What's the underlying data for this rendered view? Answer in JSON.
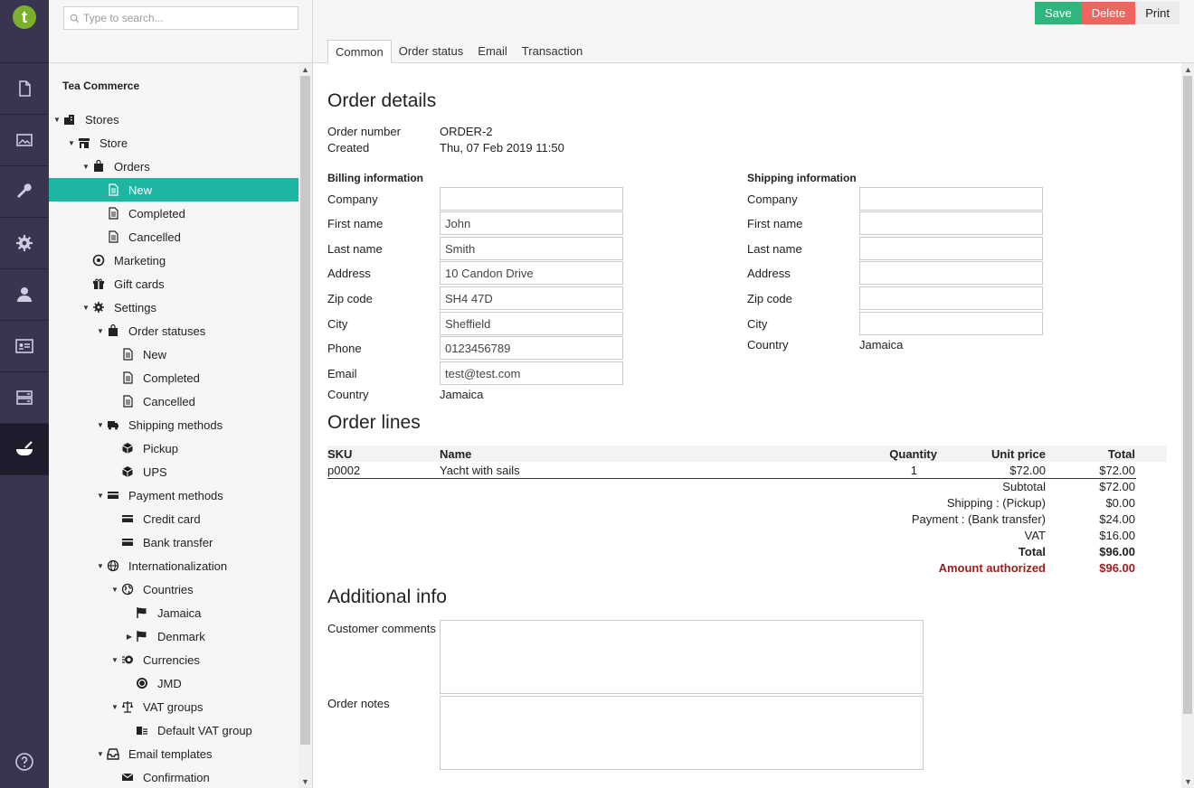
{
  "rail": {
    "logo_letter": "t",
    "items": [
      {
        "name": "content"
      },
      {
        "name": "media"
      },
      {
        "name": "developer"
      },
      {
        "name": "settings"
      },
      {
        "name": "users"
      },
      {
        "name": "members"
      },
      {
        "name": "forms"
      },
      {
        "name": "tea-commerce"
      }
    ]
  },
  "search": {
    "placeholder": "Type to search..."
  },
  "tree": {
    "section_title": "Tea Commerce",
    "nodes": [
      {
        "label": "Stores"
      },
      {
        "label": "Store"
      },
      {
        "label": "Orders"
      },
      {
        "label": "New"
      },
      {
        "label": "Completed"
      },
      {
        "label": "Cancelled"
      },
      {
        "label": "Marketing"
      },
      {
        "label": "Gift cards"
      },
      {
        "label": "Settings"
      },
      {
        "label": "Order statuses"
      },
      {
        "label": "New"
      },
      {
        "label": "Completed"
      },
      {
        "label": "Cancelled"
      },
      {
        "label": "Shipping methods"
      },
      {
        "label": "Pickup"
      },
      {
        "label": "UPS"
      },
      {
        "label": "Payment methods"
      },
      {
        "label": "Credit card"
      },
      {
        "label": "Bank transfer"
      },
      {
        "label": "Internationalization"
      },
      {
        "label": "Countries"
      },
      {
        "label": "Jamaica"
      },
      {
        "label": "Denmark"
      },
      {
        "label": "Currencies"
      },
      {
        "label": "JMD"
      },
      {
        "label": "VAT groups"
      },
      {
        "label": "Default VAT group"
      },
      {
        "label": "Email templates"
      },
      {
        "label": "Confirmation"
      }
    ]
  },
  "toolbar": {
    "save": "Save",
    "delete": "Delete",
    "print": "Print"
  },
  "tabs": [
    "Common",
    "Order status",
    "Email",
    "Transaction"
  ],
  "order_details": {
    "heading": "Order details",
    "order_number_label": "Order number",
    "order_number": "ORDER-2",
    "created_label": "Created",
    "created": "Thu, 07 Feb 2019 11:50"
  },
  "billing": {
    "title": "Billing information",
    "company_label": "Company",
    "company": "",
    "first_name_label": "First name",
    "first_name": "John",
    "last_name_label": "Last name",
    "last_name": "Smith",
    "address_label": "Address",
    "address": "10 Candon Drive",
    "zip_label": "Zip code",
    "zip": "SH4 47D",
    "city_label": "City",
    "city": "Sheffield",
    "phone_label": "Phone",
    "phone": "0123456789",
    "email_label": "Email",
    "email": "test@test.com",
    "country_label": "Country",
    "country": "Jamaica"
  },
  "shipping": {
    "title": "Shipping information",
    "company_label": "Company",
    "company": "",
    "first_name_label": "First name",
    "first_name": "",
    "last_name_label": "Last name",
    "last_name": "",
    "address_label": "Address",
    "address": "",
    "zip_label": "Zip code",
    "zip": "",
    "city_label": "City",
    "city": "",
    "country_label": "Country",
    "country": "Jamaica"
  },
  "order_lines": {
    "heading": "Order lines",
    "columns": {
      "sku": "SKU",
      "name": "Name",
      "quantity": "Quantity",
      "unit_price": "Unit price",
      "total": "Total"
    },
    "rows": [
      {
        "sku": "p0002",
        "name": "Yacht with sails",
        "quantity": "1",
        "unit_price": "$72.00",
        "total": "$72.00"
      }
    ],
    "summary": {
      "subtotal_label": "Subtotal",
      "subtotal": "$72.00",
      "shipping_label": "Shipping : (Pickup)",
      "shipping": "$0.00",
      "payment_label": "Payment : (Bank transfer)",
      "payment": "$24.00",
      "vat_label": "VAT",
      "vat": "$16.00",
      "total_label": "Total",
      "total": "$96.00",
      "authorized_label": "Amount authorized",
      "authorized": "$96.00"
    }
  },
  "additional": {
    "heading": "Additional info",
    "comments_label": "Customer comments",
    "comments": "",
    "notes_label": "Order notes",
    "notes": ""
  },
  "colors": {
    "rail": "#3b3450",
    "active": "#1fb5a3",
    "save": "#2eb67d",
    "delete": "#f0645f",
    "authorized": "#9b1c1c"
  }
}
